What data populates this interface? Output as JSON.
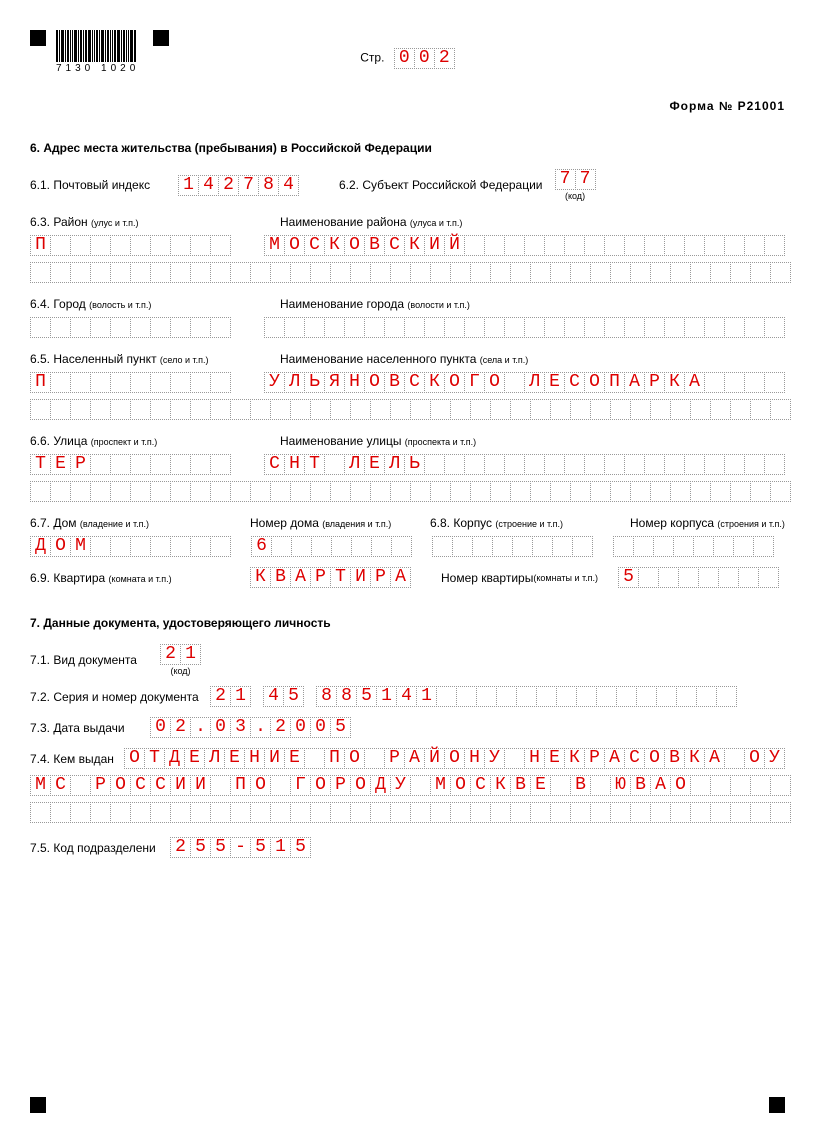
{
  "page": {
    "str_label": "Стр.",
    "number": "002",
    "form_label": "Форма № Р21001",
    "barcode_num": "7130 1020"
  },
  "s6": {
    "heading": "6.    Адрес места жительства (пребывания) в Российской Федерации",
    "f61": {
      "label": "6.1. Почтовый индекс",
      "value": "142784"
    },
    "f62": {
      "label": "6.2. Субъект Российской Федерации",
      "value": "77",
      "sub": "(код)"
    },
    "f63": {
      "label": "6.3. Район ",
      "small": "(улус и т.п.)",
      "name_label": "Наименование района ",
      "name_small": "(улуса и т.п.)",
      "type": "П",
      "name_line1": "МОСКОВСКИЙ",
      "name_line2": ""
    },
    "f64": {
      "label": "6.4. Город ",
      "small": "(волость и т.п.)",
      "name_label": "Наименование города ",
      "name_small": "(волости и т.п.)",
      "type": "",
      "name_line1": ""
    },
    "f65": {
      "label": "6.5. Населенный пункт ",
      "small": "(село и т.п.)",
      "name_label": "Наименование населенного пункта ",
      "name_small": "(села и т.п.)",
      "type": "П",
      "name_line1": "УЛЬЯНОВСКОГО ЛЕСОПАРКА",
      "name_line2": ""
    },
    "f66": {
      "label": "6.6. Улица ",
      "small": "(проспект и т.п.)",
      "name_label": "Наименование улицы ",
      "name_small": "(проспекта и т.п.)",
      "type": "ТЕР",
      "name_line1": "СНТ ЛЕЛЬ",
      "name_line2": ""
    },
    "f67": {
      "label": "6.7. Дом ",
      "small": "(владение и т.п.)",
      "num_label": "Номер дома ",
      "num_small": "(владения и т.п.)",
      "type": "ДОМ",
      "num": "6"
    },
    "f68": {
      "label": "6.8. Корпус ",
      "small": "(строение и т.п.)",
      "num_label": "Номер корпуса ",
      "num_small": "(строения и т.п.)",
      "type": "",
      "num": ""
    },
    "f69": {
      "label": "6.9. Квартира ",
      "small": "(комната и т.п.)",
      "type": "КВАРТИРА",
      "num_label": "Номер квартиры ",
      "num_small": "(комнаты и т.п.)",
      "num": "5"
    }
  },
  "s7": {
    "heading": "7.    Данные документа, удостоверяющего личность",
    "f71": {
      "label": "7.1. Вид документа",
      "value": "21",
      "sub": "(код)"
    },
    "f72": {
      "label": "7.2. Серия и номер документа",
      "p1": "21",
      "p2": "45",
      "p3": "885141"
    },
    "f73": {
      "label": "7.3. Дата выдачи",
      "value": "02.03.2005"
    },
    "f74": {
      "label": "7.4. Кем выдан",
      "line1": "ОТДЕЛЕНИЕ ПО РАЙОНУ НЕКРАСОВКА ОУФ",
      "line2": "МС РОССИИ ПО ГОРОДУ МОСКВЕ В ЮВАО",
      "line3": ""
    },
    "f75": {
      "label": "7.5. Код подразделени",
      "value": "255-515"
    }
  }
}
